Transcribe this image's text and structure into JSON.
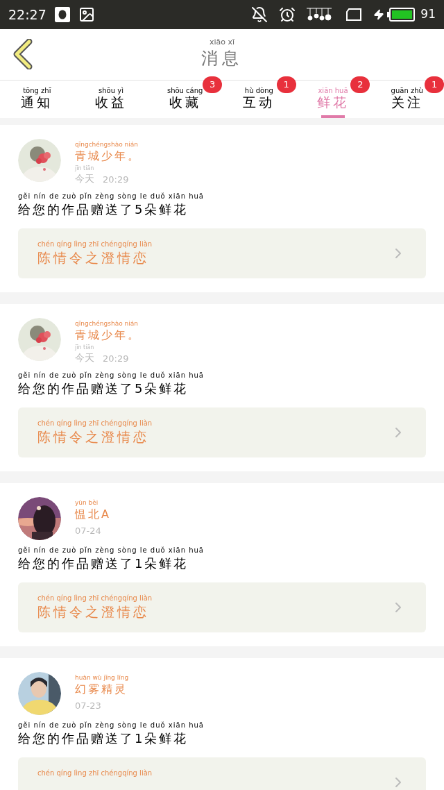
{
  "status_bar": {
    "time": "22:27",
    "battery_level": "91"
  },
  "header": {
    "title": {
      "pinyin": "xiāo xī",
      "text": "消息"
    }
  },
  "tabs": [
    {
      "pinyin": "tōng zhī",
      "text": "通知",
      "selected": false
    },
    {
      "pinyin": "shōu yì",
      "text": "收益",
      "selected": false
    },
    {
      "pinyin": "shōu cáng",
      "text": "收藏",
      "selected": false,
      "badge": "3"
    },
    {
      "pinyin": "hù dòng",
      "text": "互动",
      "selected": false,
      "badge": "1"
    },
    {
      "pinyin": "xiān huā",
      "text": "鲜花",
      "selected": true,
      "badge": "2"
    },
    {
      "pinyin": "guān zhù",
      "text": "关注",
      "selected": false,
      "badge": "1"
    }
  ],
  "messages": [
    {
      "name": {
        "pinyin": "qīngchéngshào nián",
        "text": "青城少年。"
      },
      "time": {
        "pinyin": "jīn tiān",
        "text": "今天",
        "clock": "20:29"
      },
      "body": {
        "pinyin": "gěi nín de zuò pǐn zèng sòng le duǒ xiān huā",
        "text": "给您的作品赠送了5朵鲜花"
      },
      "work": {
        "pinyin": "chén qíng lìng zhī chéngqíng liàn",
        "text": "陈情令之澄情恋"
      }
    },
    {
      "name": {
        "pinyin": "qīngchéngshào nián",
        "text": "青城少年。"
      },
      "time": {
        "pinyin": "jīn tiān",
        "text": "今天",
        "clock": "20:29"
      },
      "body": {
        "pinyin": "gěi nín de zuò pǐn zèng sòng le duǒ xiān huā",
        "text": "给您的作品赠送了5朵鲜花"
      },
      "work": {
        "pinyin": "chén qíng lìng zhī chéngqíng liàn",
        "text": "陈情令之澄情恋"
      }
    },
    {
      "name": {
        "pinyin": "yùn bèi",
        "text": "愠北A"
      },
      "time": {
        "clock": "07-24"
      },
      "body": {
        "pinyin": "gěi nín de zuò pǐn zèng sòng le duǒ xiān huā",
        "text": "给您的作品赠送了1朵鲜花"
      },
      "work": {
        "pinyin": "chén qíng lìng zhī chéngqíng liàn",
        "text": "陈情令之澄情恋"
      }
    },
    {
      "name": {
        "pinyin": "huàn wù jīng líng",
        "text": "幻雾精灵"
      },
      "time": {
        "clock": "07-23"
      },
      "body": {
        "pinyin": "gěi nín de zuò pǐn zèng sòng le duǒ xiān huā",
        "text": "给您的作品赠送了1朵鲜花"
      },
      "work": {
        "pinyin": "chén qíng lìng zhī chéngqíng liàn"
      }
    }
  ]
}
